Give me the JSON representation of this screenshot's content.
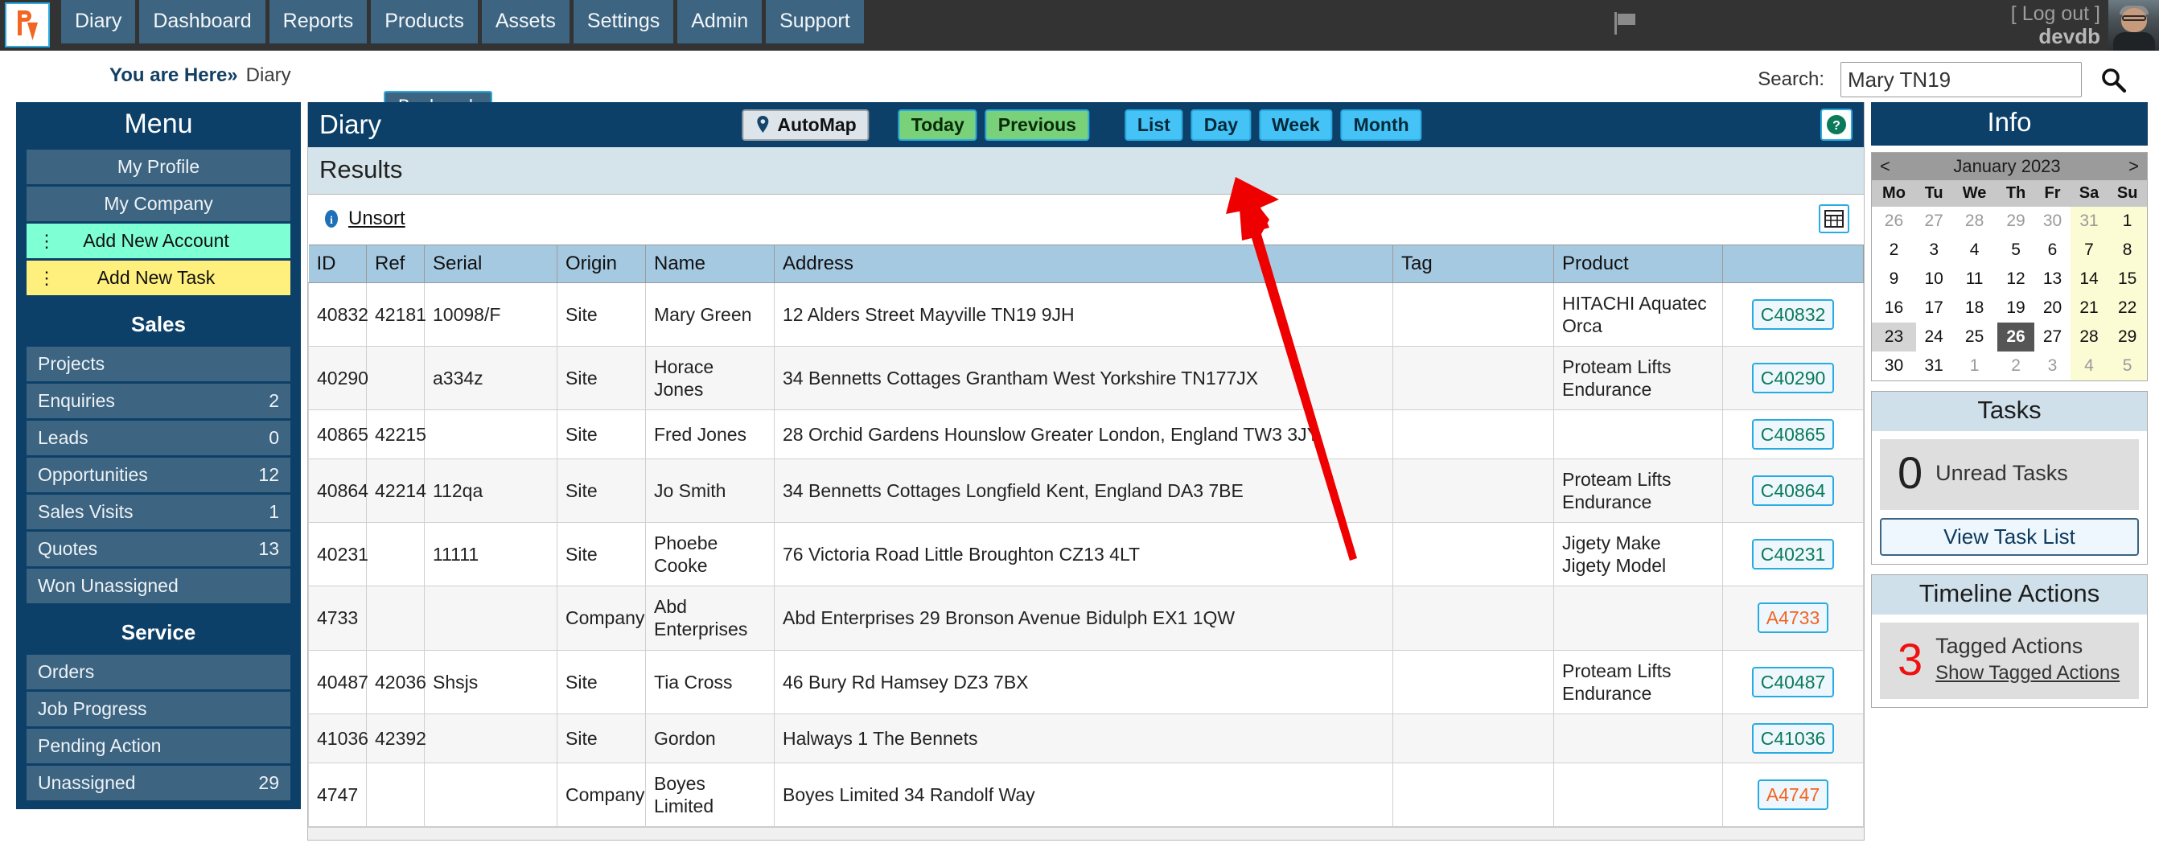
{
  "topnav": {
    "logo_icon": "av-logo-icon",
    "tabs": [
      {
        "label": "Diary"
      },
      {
        "label": "Dashboard"
      },
      {
        "label": "Reports"
      },
      {
        "label": "Products"
      },
      {
        "label": "Assets"
      },
      {
        "label": "Settings"
      },
      {
        "label": "Admin"
      },
      {
        "label": "Support"
      }
    ],
    "flag_icon": "flag-icon",
    "logout_label": "[ Log out ]",
    "username": "devdb",
    "avatar_icon": "user-avatar"
  },
  "crumb": {
    "prefix": "You are Here",
    "separator": "»",
    "current": "Diary",
    "bookmark_label": "Bookmark"
  },
  "search": {
    "label": "Search:",
    "value": "Mary TN19",
    "placeholder": "",
    "icon": "search-icon"
  },
  "sidebar": {
    "title": "Menu",
    "items": [
      {
        "label": "My Profile",
        "count": "",
        "style": "plain"
      },
      {
        "label": "My Company",
        "count": "",
        "style": "plain"
      },
      {
        "label": "Add New Account",
        "count": "",
        "style": "green"
      },
      {
        "label": "Add New Task",
        "count": "",
        "style": "yellow"
      }
    ],
    "sections": [
      {
        "title": "Sales",
        "items": [
          {
            "label": "Projects",
            "count": ""
          },
          {
            "label": "Enquiries",
            "count": "2"
          },
          {
            "label": "Leads",
            "count": "0"
          },
          {
            "label": "Opportunities",
            "count": "12"
          },
          {
            "label": "Sales Visits",
            "count": "1"
          },
          {
            "label": "Quotes",
            "count": "13"
          },
          {
            "label": "Won Unassigned",
            "count": ""
          }
        ]
      },
      {
        "title": "Service",
        "items": [
          {
            "label": "Orders",
            "count": ""
          },
          {
            "label": "Job Progress",
            "count": ""
          },
          {
            "label": "Pending Action",
            "count": ""
          },
          {
            "label": "Unassigned",
            "count": "29"
          }
        ]
      }
    ]
  },
  "main": {
    "title": "Diary",
    "automap_label": "AutoMap",
    "automap_icon": "map-pin-icon",
    "buttons": [
      {
        "label": "Today",
        "style": "green"
      },
      {
        "label": "Previous",
        "style": "green"
      },
      {
        "label": "List",
        "style": "blue"
      },
      {
        "label": "Day",
        "style": "blue"
      },
      {
        "label": "Week",
        "style": "blue"
      },
      {
        "label": "Month",
        "style": "blue"
      }
    ],
    "help_icon": "help-question-icon",
    "results_title": "Results",
    "unsort_label": "Unsort",
    "unsort_icon": "info-icon",
    "grid_icon": "grid-table-icon",
    "columns": [
      "ID",
      "Ref",
      "Serial",
      "Origin",
      "Name",
      "Address",
      "Tag",
      "Product",
      ""
    ],
    "rows": [
      {
        "id": "40832",
        "ref": "42181",
        "serial": "10098/F",
        "origin": "Site",
        "name": "Mary Green",
        "address": "12 Alders Street Mayville TN19 9JH",
        "tag": "",
        "product": "HITACHI Aquatec Orca",
        "button": "C40832"
      },
      {
        "id": "40290",
        "ref": "",
        "serial": "a334z",
        "origin": "Site",
        "name": "Horace Jones",
        "address": "34 Bennetts Cottages Grantham West Yorkshire TN177JX",
        "tag": "",
        "product": "Proteam Lifts Endurance",
        "button": "C40290"
      },
      {
        "id": "40865",
        "ref": "42215",
        "serial": "",
        "origin": "Site",
        "name": "Fred Jones",
        "address": "28 Orchid Gardens Hounslow Greater London, England TW3 3JY",
        "tag": "",
        "product": "",
        "button": "C40865"
      },
      {
        "id": "40864",
        "ref": "42214",
        "serial": "112qa",
        "origin": "Site",
        "name": "Jo Smith",
        "address": "34 Bennetts Cottages Longfield Kent, England DA3 7BE",
        "tag": "",
        "product": "Proteam Lifts Endurance",
        "button": "C40864"
      },
      {
        "id": "40231",
        "ref": "",
        "serial": "11111",
        "origin": "Site",
        "name": "Phoebe Cooke",
        "address": "76 Victoria Road Little Broughton CZ13 4LT",
        "tag": "",
        "product": "Jigety Make Jigety Model",
        "button": "C40231"
      },
      {
        "id": "4733",
        "ref": "",
        "serial": "",
        "origin": "Company",
        "name": "Abd Enterprises",
        "address": "Abd Enterprises 29 Bronson Avenue Bidulph EX1 1QW",
        "tag": "",
        "product": "",
        "button": "A4733"
      },
      {
        "id": "40487",
        "ref": "42036",
        "serial": "Shsjs",
        "origin": "Site",
        "name": "Tia Cross",
        "address": "46 Bury Rd Hamsey DZ3 7BX",
        "tag": "",
        "product": "Proteam Lifts Endurance",
        "button": "C40487"
      },
      {
        "id": "41036",
        "ref": "42392",
        "serial": "",
        "origin": "Site",
        "name": "Gordon",
        "address": "Halways 1 The Bennets",
        "tag": "",
        "product": "",
        "button": "C41036"
      },
      {
        "id": "4747",
        "ref": "",
        "serial": "",
        "origin": "Company",
        "name": "Boyes Limited",
        "address": "Boyes Limited 34 Randolf Way",
        "tag": "",
        "product": "",
        "button": "A4747"
      }
    ]
  },
  "info": {
    "title": "Info",
    "calendar": {
      "prev": "<",
      "next": ">",
      "month_label": "January 2023",
      "weekdays": [
        "Mo",
        "Tu",
        "We",
        "Th",
        "Fr",
        "Sa",
        "Su"
      ],
      "weeks": [
        [
          {
            "d": "26",
            "m": 1
          },
          {
            "d": "27",
            "m": 1
          },
          {
            "d": "28",
            "m": 1
          },
          {
            "d": "29",
            "m": 1
          },
          {
            "d": "30",
            "m": 1
          },
          {
            "d": "31",
            "m": 1,
            "we": 1
          },
          {
            "d": "1",
            "we": 1
          }
        ],
        [
          {
            "d": "2"
          },
          {
            "d": "3"
          },
          {
            "d": "4"
          },
          {
            "d": "5"
          },
          {
            "d": "6"
          },
          {
            "d": "7",
            "we": 1
          },
          {
            "d": "8",
            "we": 1
          }
        ],
        [
          {
            "d": "9"
          },
          {
            "d": "10"
          },
          {
            "d": "11"
          },
          {
            "d": "12"
          },
          {
            "d": "13"
          },
          {
            "d": "14",
            "we": 1
          },
          {
            "d": "15",
            "we": 1
          }
        ],
        [
          {
            "d": "16"
          },
          {
            "d": "17"
          },
          {
            "d": "18"
          },
          {
            "d": "19"
          },
          {
            "d": "20"
          },
          {
            "d": "21",
            "we": 1
          },
          {
            "d": "22",
            "we": 1
          }
        ],
        [
          {
            "d": "23",
            "hl": 1
          },
          {
            "d": "24"
          },
          {
            "d": "25"
          },
          {
            "d": "26",
            "sel": 1
          },
          {
            "d": "27"
          },
          {
            "d": "28",
            "we": 1
          },
          {
            "d": "29",
            "we": 1
          }
        ],
        [
          {
            "d": "30"
          },
          {
            "d": "31"
          },
          {
            "d": "1",
            "m": 1
          },
          {
            "d": "2",
            "m": 1
          },
          {
            "d": "3",
            "m": 1
          },
          {
            "d": "4",
            "m": 1,
            "we": 1
          },
          {
            "d": "5",
            "m": 1,
            "we": 1
          }
        ]
      ]
    },
    "tasks": {
      "title": "Tasks",
      "count": "0",
      "count_label": "Unread Tasks",
      "button_label": "View Task List"
    },
    "timeline": {
      "title": "Timeline Actions",
      "count": "3",
      "count_label": "Tagged Actions",
      "link_label": "Show Tagged Actions"
    }
  },
  "annotation": {
    "arrow_color": "#ee0000"
  }
}
